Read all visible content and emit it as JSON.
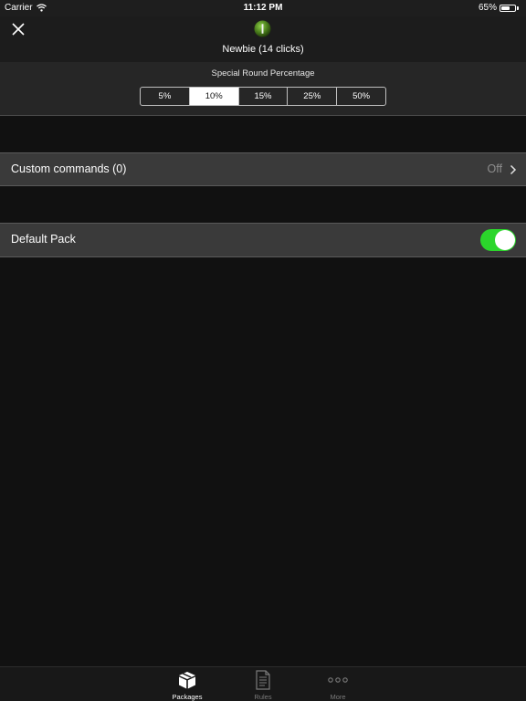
{
  "status_bar": {
    "carrier": "Carrier",
    "time": "11:12 PM",
    "battery_percent": "65%",
    "battery_level": 0.65,
    "wifi_icon": "wifi-icon",
    "battery_icon": "battery-icon"
  },
  "header": {
    "close_icon": "close-icon",
    "rank_icon": "rank-badge-icon",
    "title": "Newbie (14 clicks)"
  },
  "special_round": {
    "label": "Special Round Percentage",
    "options": [
      "5%",
      "10%",
      "15%",
      "25%",
      "50%"
    ],
    "selected": "10%"
  },
  "custom_commands": {
    "label": "Custom commands (0)",
    "value": "Off",
    "chevron_icon": "chevron-right-icon"
  },
  "default_pack": {
    "label": "Default Pack",
    "enabled": true
  },
  "tabs": [
    {
      "label": "Packages",
      "icon": "box-icon",
      "active": true
    },
    {
      "label": "Rules",
      "icon": "document-icon",
      "active": false
    },
    {
      "label": "More",
      "icon": "more-icon",
      "active": false
    }
  ],
  "colors": {
    "background": "#111111",
    "row_background": "#3a3a3a",
    "toggle_on": "#2bd62b",
    "badge_green": "#4a7d1c"
  }
}
